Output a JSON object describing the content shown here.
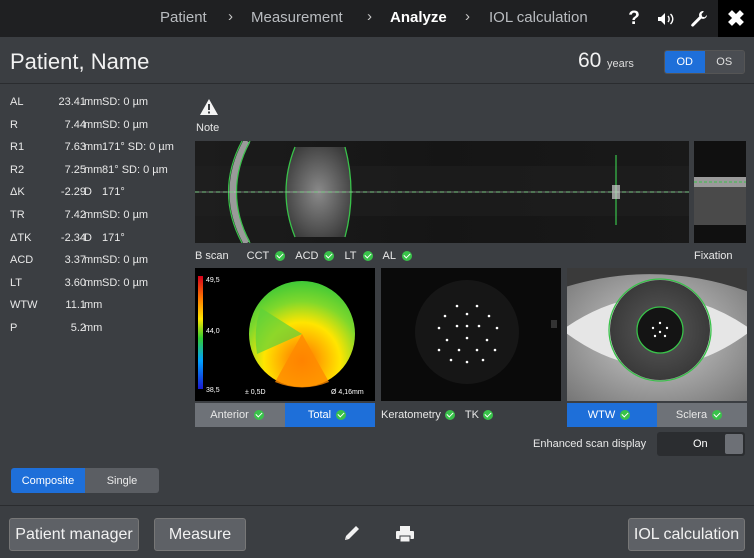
{
  "nav": {
    "crumbs": [
      "Patient",
      "Measurement",
      "Analyze",
      "IOL calculation"
    ],
    "active": "Analyze",
    "help": "?",
    "close": "✖"
  },
  "header": {
    "patient_name": "Patient, Name",
    "age": "60",
    "age_unit": "years",
    "eye_od": "OD",
    "eye_os": "OS",
    "selected_eye": "OD"
  },
  "measurements": [
    {
      "label": "AL",
      "value": "23.41",
      "unit": "mm",
      "extra": "SD: 0 µm"
    },
    {
      "label": "R",
      "value": "7.44",
      "unit": "mm",
      "extra": "SD: 0 µm"
    },
    {
      "label": "R1",
      "value": "7.63",
      "unit": "mm",
      "extra": "171° SD: 0 µm"
    },
    {
      "label": "R2",
      "value": "7.25",
      "unit": "mm",
      "extra": "81° SD: 0 µm"
    },
    {
      "label": "ΔK",
      "value": "-2.29",
      "unit": "D",
      "extra": "171°"
    },
    {
      "label": "TR",
      "value": "7.42",
      "unit": "mm",
      "extra": "SD: 0 µm"
    },
    {
      "label": "ΔTK",
      "value": "-2.34",
      "unit": "D",
      "extra": "171°"
    },
    {
      "label": "ACD",
      "value": "3.37",
      "unit": "mm",
      "extra": "SD: 0 µm"
    },
    {
      "label": "LT",
      "value": "3.60",
      "unit": "mm",
      "extra": "SD: 0 µm"
    },
    {
      "label": "WTW",
      "value": "11.1",
      "unit": "mm",
      "extra": ""
    },
    {
      "label": "P",
      "value": "5.2",
      "unit": "mm",
      "extra": ""
    }
  ],
  "note": {
    "label": "Note"
  },
  "bscan": {
    "label": "B scan",
    "checks": [
      "CCT",
      "ACD",
      "LT",
      "AL"
    ],
    "fixation_label": "Fixation"
  },
  "topo": {
    "scale_top": "49,5",
    "scale_mid": "44,0",
    "scale_bottom": "38,5",
    "sd_label": "± 0,5D",
    "diameter_label": "Ø 4,16mm",
    "tab_anterior": "Anterior",
    "tab_total": "Total",
    "selected": "Total"
  },
  "keratometry": {
    "label": "Keratometry",
    "tk": "TK"
  },
  "eye_image": {
    "tab_wtw": "WTW",
    "tab_sclera": "Sclera",
    "selected": "WTW"
  },
  "enhanced": {
    "label": "Enhanced scan display",
    "state": "On"
  },
  "mode": {
    "composite": "Composite",
    "single": "Single",
    "selected": "Composite"
  },
  "footer": {
    "patient_manager": "Patient manager",
    "measure": "Measure",
    "iol_calculation": "IOL calculation",
    "edit_icon": "pencil-icon",
    "print_icon": "printer-icon"
  }
}
